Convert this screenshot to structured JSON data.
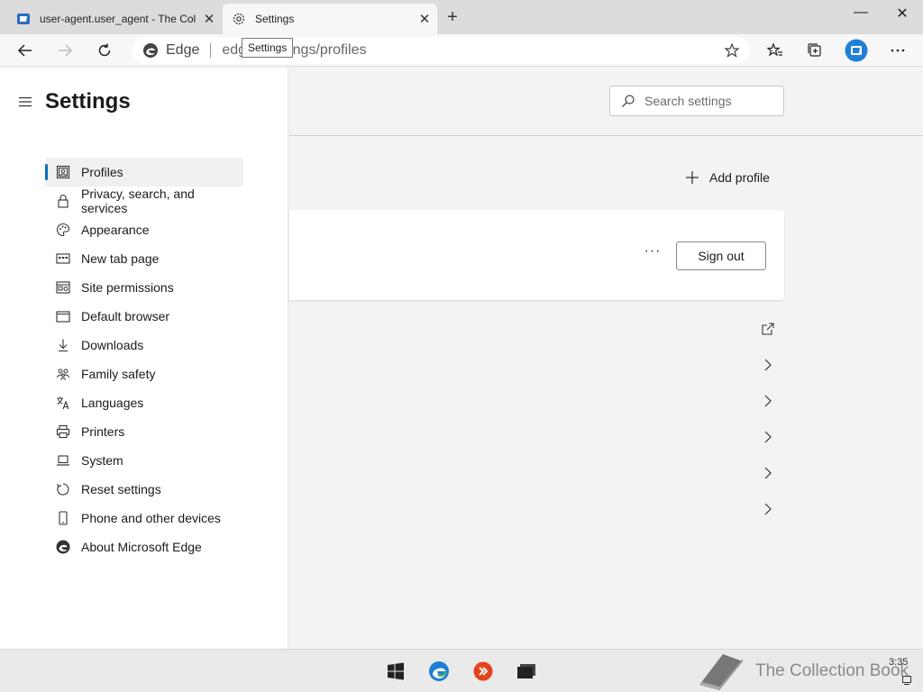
{
  "browser": {
    "tabs": [
      {
        "title": "user-agent.user_agent - The Coll",
        "close": "✕"
      },
      {
        "title": "Settings",
        "close": "✕"
      }
    ],
    "new_tab": "+",
    "window_controls": {
      "minimize": "—",
      "close": "✕"
    },
    "address": {
      "site_name": "Edge",
      "url": "edge://settings/profiles"
    },
    "tooltip": "Settings"
  },
  "settings": {
    "title": "Settings",
    "search_placeholder": "Search settings",
    "nav": [
      {
        "label": "Profiles",
        "icon": "profile-icon"
      },
      {
        "label": "Privacy, search, and services",
        "icon": "lock-icon"
      },
      {
        "label": "Appearance",
        "icon": "palette-icon"
      },
      {
        "label": "New tab page",
        "icon": "newtab-icon"
      },
      {
        "label": "Site permissions",
        "icon": "permissions-icon"
      },
      {
        "label": "Default browser",
        "icon": "browser-icon"
      },
      {
        "label": "Downloads",
        "icon": "download-icon"
      },
      {
        "label": "Family safety",
        "icon": "family-icon"
      },
      {
        "label": "Languages",
        "icon": "language-icon"
      },
      {
        "label": "Printers",
        "icon": "printer-icon"
      },
      {
        "label": "System",
        "icon": "laptop-icon"
      },
      {
        "label": "Reset settings",
        "icon": "reset-icon"
      },
      {
        "label": "Phone and other devices",
        "icon": "phone-icon"
      },
      {
        "label": "About Microsoft Edge",
        "icon": "edge-icon"
      }
    ],
    "add_profile": "Add profile",
    "more": "···",
    "sign_out": "Sign out"
  },
  "taskbar": {
    "watermark": "The Collection Book",
    "clock": "3:35"
  },
  "colors": {
    "accent": "#0f6cbd",
    "edge_blue": "#1f7fd6",
    "edge_green": "#43b85a",
    "anydesk_red": "#e3431b"
  }
}
